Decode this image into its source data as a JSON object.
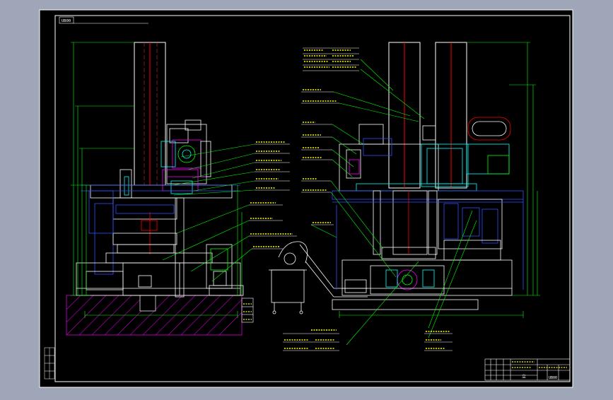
{
  "drawing_number": "UB00",
  "title_block_number": "UB00",
  "title_block_label": "立",
  "colors": {
    "background": "#9ea6b8",
    "sheet": "#000000",
    "frame": "#ffffff",
    "outline": "#ffffff",
    "dimension": "#00ff00",
    "leader": "#00ff00",
    "label": "#ffff00",
    "column": "#ff0000",
    "blue": "#3050ff",
    "magenta": "#ff00ff",
    "cyan": "#00ffff",
    "ground": "#b000b0"
  }
}
